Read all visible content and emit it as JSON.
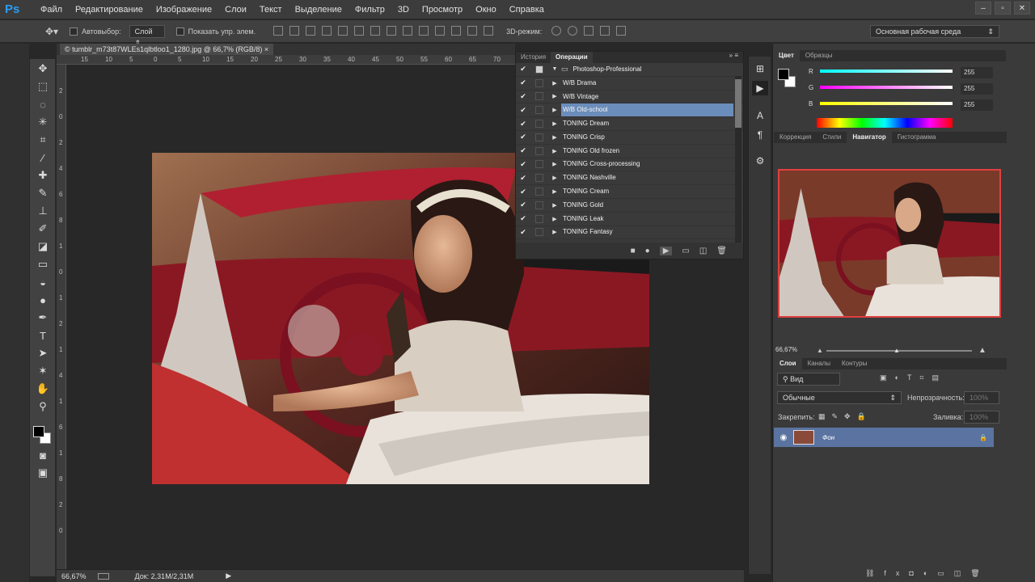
{
  "app": {
    "logo": "Ps"
  },
  "menu": [
    "Файл",
    "Редактирование",
    "Изображение",
    "Слои",
    "Текст",
    "Выделение",
    "Фильтр",
    "3D",
    "Просмотр",
    "Окно",
    "Справка"
  ],
  "options": {
    "autoselect": "Автовыбор:",
    "autoselect_value": "Слой",
    "show_controls": "Показать упр. элем.",
    "mode3d": "3D-режим:",
    "workspace": "Основная рабочая среда"
  },
  "document": {
    "tab_title": "tumblr_m73t87WLEs1qlbtloo1_1280.jpg @ 66,7% (RGB/8)",
    "ruler_h": [
      "15",
      "10",
      "5",
      "0",
      "5",
      "10",
      "15",
      "20",
      "25",
      "30",
      "35",
      "40",
      "45",
      "50",
      "55",
      "60",
      "65",
      "70"
    ],
    "ruler_v": [
      "2",
      "0",
      "2",
      "4",
      "6",
      "8",
      "1",
      "0",
      "1",
      "2",
      "1",
      "4",
      "1",
      "6",
      "1",
      "8",
      "2",
      "0"
    ]
  },
  "status": {
    "zoom": "66,67%",
    "doc": "Док: 2,31M/2,31M"
  },
  "actions_panel": {
    "tabs": [
      "История",
      "Операции"
    ],
    "set_name": "Photoshop-Professional",
    "items": [
      {
        "label": "W/B Drama",
        "selected": false
      },
      {
        "label": "W/B Vintage",
        "selected": false
      },
      {
        "label": "W/B Old-school",
        "selected": true
      },
      {
        "label": "TONING Dream",
        "selected": false
      },
      {
        "label": "TONING Crisp",
        "selected": false
      },
      {
        "label": "TONING Old frozen",
        "selected": false
      },
      {
        "label": "TONING Cross-processing",
        "selected": false
      },
      {
        "label": "TONING Nashville",
        "selected": false
      },
      {
        "label": "TONING Cream",
        "selected": false
      },
      {
        "label": "TONING Gold",
        "selected": false
      },
      {
        "label": "TONING Leak",
        "selected": false
      },
      {
        "label": "TONING Fantasy",
        "selected": false
      }
    ]
  },
  "color_panel": {
    "tabs": [
      "Цвет",
      "Образцы"
    ],
    "channels": [
      {
        "name": "R",
        "value": "255"
      },
      {
        "name": "G",
        "value": "255"
      },
      {
        "name": "B",
        "value": "255"
      }
    ]
  },
  "nav_panel": {
    "tabs": [
      "Коррекция",
      "Стили",
      "Навигатор",
      "Гистограмма"
    ],
    "zoom": "66,67%"
  },
  "layers_panel": {
    "tabs": [
      "Слои",
      "Каналы",
      "Контуры"
    ],
    "filter": "Вид",
    "blend": "Обычные",
    "opacity_label": "Непрозрачность:",
    "opacity": "100%",
    "lock_label": "Закрепить:",
    "fill_label": "Заливка:",
    "fill": "100%",
    "layer_name": "Фон"
  },
  "colors": {
    "accent": "#2e9cf0",
    "selected_row": "#6b8dbb",
    "layer_selected": "#5a73a0",
    "nav_frame": "#e04040"
  }
}
